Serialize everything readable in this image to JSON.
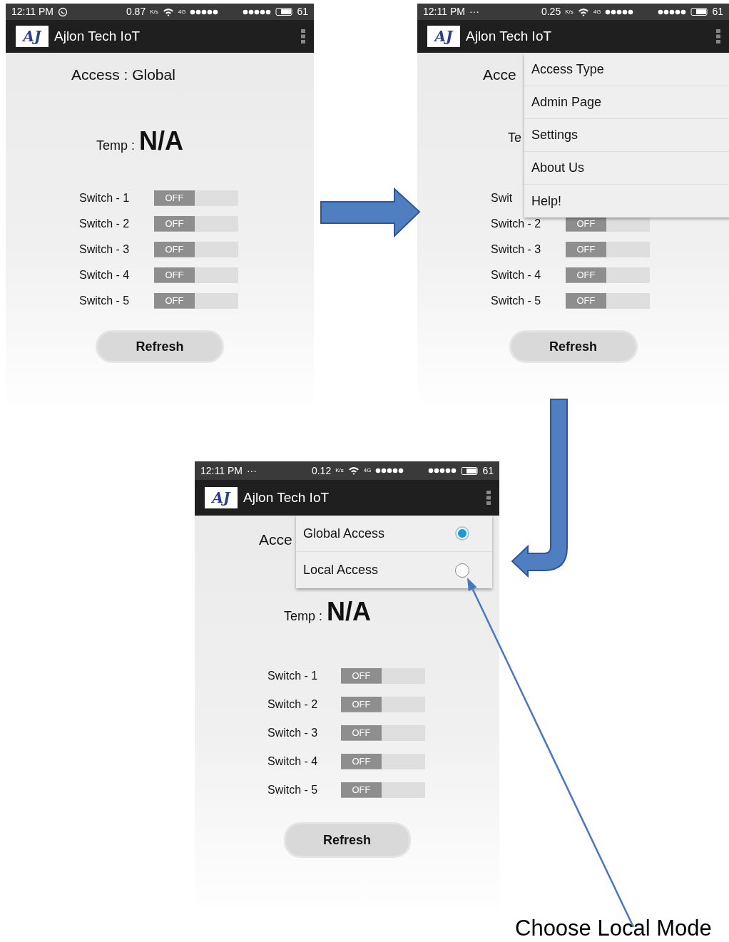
{
  "screens": [
    {
      "status_bar": {
        "time": "12:11 PM",
        "speed": "0.87",
        "speed_unit": "K/s",
        "network": "4G",
        "battery": "61"
      },
      "app_bar": {
        "logo": "AJ",
        "title": "Ajlon Tech IoT"
      },
      "access": "Access : Global",
      "temp_label": "Temp :",
      "temp_value": "N/A",
      "switches": [
        {
          "label": "Switch - 1",
          "on": false,
          "state": "OFF"
        },
        {
          "label": "Switch - 2",
          "on": false,
          "state": "OFF"
        },
        {
          "label": "Switch - 3",
          "on": false,
          "state": "OFF"
        },
        {
          "label": "Switch - 4",
          "on": false,
          "state": "OFF"
        },
        {
          "label": "Switch - 5",
          "on": false,
          "state": "OFF"
        }
      ],
      "refresh": "Refresh"
    },
    {
      "status_bar": {
        "time": "12:11 PM",
        "notification": "···",
        "speed": "0.25",
        "speed_unit": "K/s",
        "network": "4G",
        "battery": "61"
      },
      "app_bar": {
        "logo": "AJ",
        "title": "Ajlon Tech IoT"
      },
      "access": "Acce",
      "temp_label": "Te",
      "switches": [
        {
          "label": "Swit"
        },
        {
          "label": "Switch - 2",
          "on": false,
          "state": "OFF"
        },
        {
          "label": "Switch - 3",
          "on": false,
          "state": "OFF"
        },
        {
          "label": "Switch - 4",
          "on": false,
          "state": "OFF"
        },
        {
          "label": "Switch - 5",
          "on": false,
          "state": "OFF"
        }
      ],
      "refresh": "Refresh",
      "menu": {
        "kind": "options",
        "items": [
          {
            "label": "Access Type"
          },
          {
            "label": "Admin Page"
          },
          {
            "label": "Settings"
          },
          {
            "label": "About Us"
          },
          {
            "label": "Help!"
          }
        ]
      }
    },
    {
      "status_bar": {
        "time": "12:11 PM",
        "notification": "···",
        "speed": "0.12",
        "speed_unit": "K/s",
        "network": "4G",
        "battery": "61"
      },
      "app_bar": {
        "logo": "AJ",
        "title": "Ajlon Tech IoT"
      },
      "access": "Acce",
      "temp_label": "Temp :",
      "temp_value": "N/A",
      "switches": [
        {
          "label": "Switch - 1",
          "on": false,
          "state": "OFF"
        },
        {
          "label": "Switch - 2",
          "on": false,
          "state": "OFF"
        },
        {
          "label": "Switch - 3",
          "on": false,
          "state": "OFF"
        },
        {
          "label": "Switch - 4",
          "on": false,
          "state": "OFF"
        },
        {
          "label": "Switch - 5",
          "on": false,
          "state": "OFF"
        }
      ],
      "refresh": "Refresh",
      "menu": {
        "kind": "radio",
        "items": [
          {
            "label": "Global Access",
            "selected": true
          },
          {
            "label": "Local Access",
            "selected": false
          }
        ]
      }
    }
  ],
  "caption": "Choose Local Mode"
}
